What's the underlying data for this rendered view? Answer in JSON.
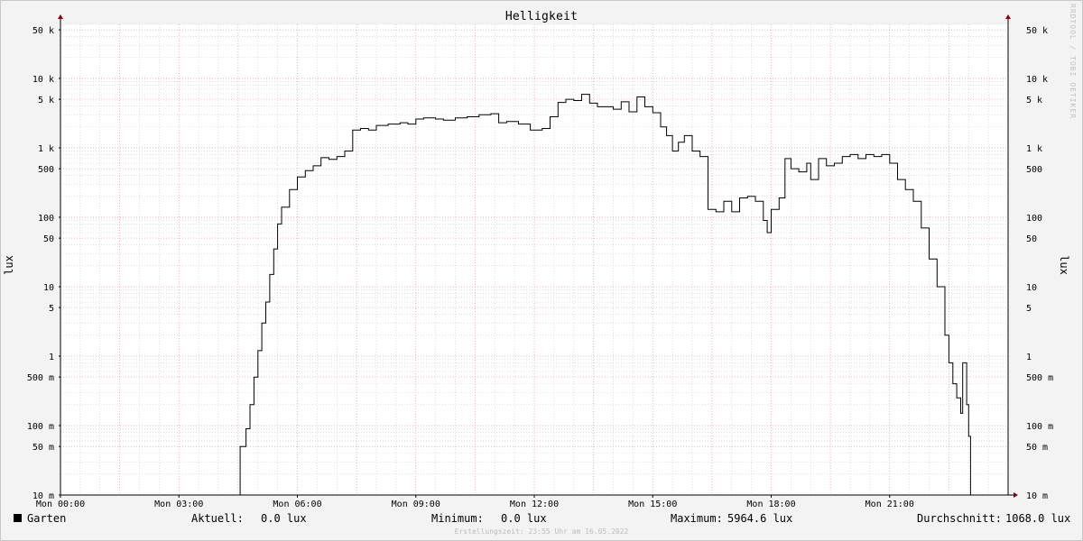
{
  "chart_data": {
    "type": "line",
    "title": "Helligkeit",
    "ylabel": "lux",
    "yscale": "log",
    "ylim": [
      0.01,
      60000
    ],
    "xlim": [
      0,
      24
    ],
    "x_ticks": [
      {
        "x": 0,
        "label": "Mon 00:00"
      },
      {
        "x": 3,
        "label": "Mon 03:00"
      },
      {
        "x": 6,
        "label": "Mon 06:00"
      },
      {
        "x": 9,
        "label": "Mon 09:00"
      },
      {
        "x": 12,
        "label": "Mon 12:00"
      },
      {
        "x": 15,
        "label": "Mon 15:00"
      },
      {
        "x": 18,
        "label": "Mon 18:00"
      },
      {
        "x": 21,
        "label": "Mon 21:00"
      }
    ],
    "y_ticks": [
      {
        "v": 50000,
        "label": "50 k"
      },
      {
        "v": 10000,
        "label": "10 k"
      },
      {
        "v": 5000,
        "label": "5 k"
      },
      {
        "v": 1000,
        "label": "1 k"
      },
      {
        "v": 500,
        "label": "500"
      },
      {
        "v": 100,
        "label": "100"
      },
      {
        "v": 50,
        "label": "50"
      },
      {
        "v": 10,
        "label": "10"
      },
      {
        "v": 5,
        "label": "5"
      },
      {
        "v": 1,
        "label": "1"
      },
      {
        "v": 0.5,
        "label": "500 m"
      },
      {
        "v": 0.1,
        "label": "100 m"
      },
      {
        "v": 0.05,
        "label": "50 m"
      },
      {
        "v": 0.01,
        "label": "10 m"
      }
    ],
    "grid": true,
    "color": "#000000",
    "series": [
      {
        "name": "Garten",
        "points": [
          [
            0.0,
            0.01
          ],
          [
            4.5,
            0.01
          ],
          [
            4.55,
            0.05
          ],
          [
            4.7,
            0.09
          ],
          [
            4.8,
            0.2
          ],
          [
            4.9,
            0.5
          ],
          [
            5.0,
            1.2
          ],
          [
            5.1,
            3
          ],
          [
            5.2,
            6
          ],
          [
            5.3,
            15
          ],
          [
            5.4,
            35
          ],
          [
            5.5,
            80
          ],
          [
            5.6,
            140
          ],
          [
            5.8,
            250
          ],
          [
            6.0,
            380
          ],
          [
            6.2,
            470
          ],
          [
            6.4,
            550
          ],
          [
            6.6,
            720
          ],
          [
            6.8,
            680
          ],
          [
            7.0,
            750
          ],
          [
            7.2,
            900
          ],
          [
            7.4,
            1800
          ],
          [
            7.6,
            1900
          ],
          [
            7.8,
            1800
          ],
          [
            8.0,
            2100
          ],
          [
            8.3,
            2200
          ],
          [
            8.6,
            2300
          ],
          [
            8.8,
            2200
          ],
          [
            9.0,
            2600
          ],
          [
            9.2,
            2700
          ],
          [
            9.5,
            2600
          ],
          [
            9.7,
            2500
          ],
          [
            10.0,
            2700
          ],
          [
            10.3,
            2800
          ],
          [
            10.6,
            3000
          ],
          [
            10.9,
            3100
          ],
          [
            11.1,
            2300
          ],
          [
            11.3,
            2400
          ],
          [
            11.6,
            2200
          ],
          [
            11.9,
            1800
          ],
          [
            12.2,
            1900
          ],
          [
            12.4,
            2800
          ],
          [
            12.6,
            4500
          ],
          [
            12.8,
            5000
          ],
          [
            13.0,
            4800
          ],
          [
            13.2,
            5900
          ],
          [
            13.4,
            4400
          ],
          [
            13.6,
            3900
          ],
          [
            13.8,
            3900
          ],
          [
            14.0,
            3600
          ],
          [
            14.2,
            4600
          ],
          [
            14.4,
            3300
          ],
          [
            14.6,
            5400
          ],
          [
            14.8,
            3900
          ],
          [
            15.0,
            3200
          ],
          [
            15.2,
            2000
          ],
          [
            15.35,
            1500
          ],
          [
            15.5,
            900
          ],
          [
            15.65,
            1200
          ],
          [
            15.8,
            1500
          ],
          [
            16.0,
            900
          ],
          [
            16.2,
            750
          ],
          [
            16.4,
            130
          ],
          [
            16.6,
            120
          ],
          [
            16.8,
            170
          ],
          [
            17.0,
            120
          ],
          [
            17.2,
            190
          ],
          [
            17.4,
            200
          ],
          [
            17.6,
            170
          ],
          [
            17.8,
            90
          ],
          [
            17.9,
            60
          ],
          [
            18.0,
            130
          ],
          [
            18.2,
            190
          ],
          [
            18.35,
            700
          ],
          [
            18.5,
            500
          ],
          [
            18.7,
            450
          ],
          [
            18.9,
            600
          ],
          [
            19.0,
            350
          ],
          [
            19.2,
            700
          ],
          [
            19.4,
            550
          ],
          [
            19.6,
            600
          ],
          [
            19.8,
            750
          ],
          [
            20.0,
            800
          ],
          [
            20.2,
            700
          ],
          [
            20.4,
            800
          ],
          [
            20.6,
            750
          ],
          [
            20.8,
            800
          ],
          [
            21.0,
            600
          ],
          [
            21.2,
            350
          ],
          [
            21.4,
            250
          ],
          [
            21.6,
            170
          ],
          [
            21.8,
            70
          ],
          [
            22.0,
            25
          ],
          [
            22.2,
            10
          ],
          [
            22.4,
            2
          ],
          [
            22.5,
            0.8
          ],
          [
            22.6,
            0.4
          ],
          [
            22.7,
            0.25
          ],
          [
            22.8,
            0.15
          ],
          [
            22.85,
            0.8
          ],
          [
            22.9,
            0.8
          ],
          [
            22.95,
            0.2
          ],
          [
            23.0,
            0.07
          ],
          [
            23.05,
            0.01
          ],
          [
            24.0,
            0.01
          ]
        ]
      }
    ]
  },
  "legend": {
    "series_name": "Garten",
    "current_label": "Aktuell:",
    "current_value": "0.0 lux",
    "min_label": "Minimum:",
    "min_value": "0.0 lux",
    "max_label": "Maximum:",
    "max_value": "5964.6 lux",
    "avg_label": "Durchschnitt:",
    "avg_value": "1068.0 lux"
  },
  "footer": "Erstellungszeit: 23:55 Uhr am 16.05.2022",
  "credit": "RRDTOOL / TOBI OETIKER",
  "colors": {
    "grid_major": "#e6a0a8",
    "grid_minor": "#c8c8c8",
    "line": "#000000",
    "arrow": "#8b0000"
  }
}
